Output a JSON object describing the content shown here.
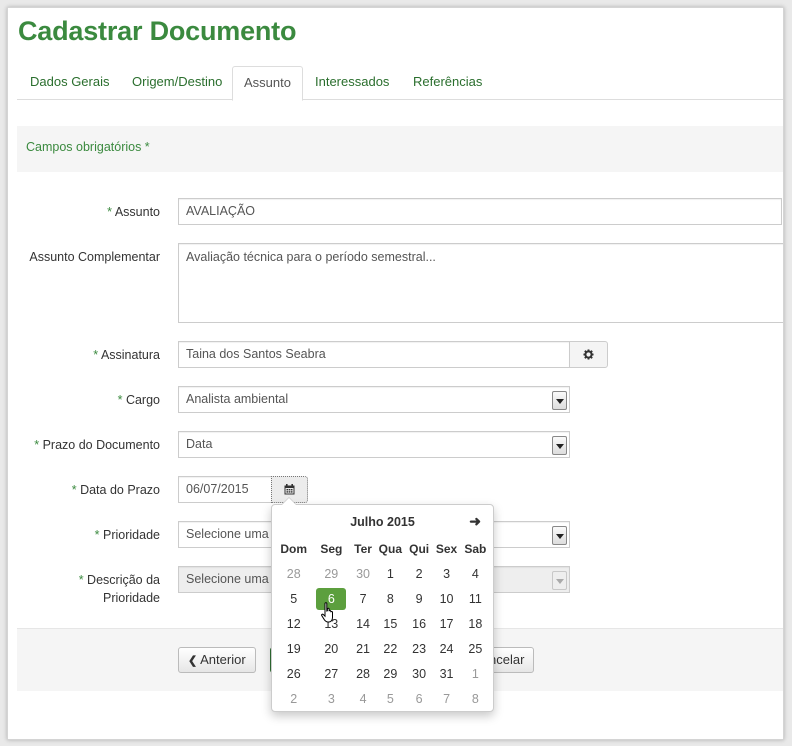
{
  "page": {
    "title": "Cadastrar Documento"
  },
  "tabs": [
    {
      "label": "Dados Gerais"
    },
    {
      "label": "Origem/Destino"
    },
    {
      "label": "Assunto",
      "active": true
    },
    {
      "label": "Interessados"
    },
    {
      "label": "Referências"
    }
  ],
  "required_note": "Campos obrigatórios *",
  "form": {
    "required_mark": "*",
    "assunto": {
      "label": "Assunto",
      "value": "AVALIAÇÃO"
    },
    "assunto_complementar": {
      "label": "Assunto Complementar",
      "value": "Avaliação técnica para o período semestral..."
    },
    "assinatura": {
      "label": "Assinatura",
      "value": "Taina dos Santos Seabra",
      "button_icon": "gear-icon"
    },
    "cargo": {
      "label": "Cargo",
      "value": "Analista ambiental"
    },
    "prazo": {
      "label": "Prazo do Documento",
      "value": "Data"
    },
    "data_prazo": {
      "label": "Data do Prazo",
      "value": "06/07/2015",
      "button_icon": "calendar-icon"
    },
    "prioridade": {
      "label": "Prioridade",
      "value": "Selecione uma"
    },
    "descricao_prioridade": {
      "label_line1": "Descrição da",
      "label_line2": "Prioridade",
      "value": "Selecione uma",
      "disabled": true
    }
  },
  "buttons": {
    "anterior": "Anterior",
    "cancelar": "ncelar"
  },
  "datepicker": {
    "month_label": "Julho 2015",
    "next_icon": "arrow-right-icon",
    "weekdays": [
      "Dom",
      "Seg",
      "Ter",
      "Qua",
      "Qui",
      "Sex",
      "Sab"
    ],
    "selected": "6",
    "weeks": [
      [
        "28",
        "29",
        "30",
        "1",
        "2",
        "3",
        "4"
      ],
      [
        "5",
        "6",
        "7",
        "8",
        "9",
        "10",
        "11"
      ],
      [
        "12",
        "13",
        "14",
        "15",
        "16",
        "17",
        "18"
      ],
      [
        "19",
        "20",
        "21",
        "22",
        "23",
        "24",
        "25"
      ],
      [
        "26",
        "27",
        "28",
        "29",
        "30",
        "31",
        "1"
      ],
      [
        "2",
        "3",
        "4",
        "5",
        "6",
        "7",
        "8"
      ]
    ]
  },
  "colors": {
    "brand_green": "#3b8a3f",
    "selected_day": "#5c9f3e"
  }
}
